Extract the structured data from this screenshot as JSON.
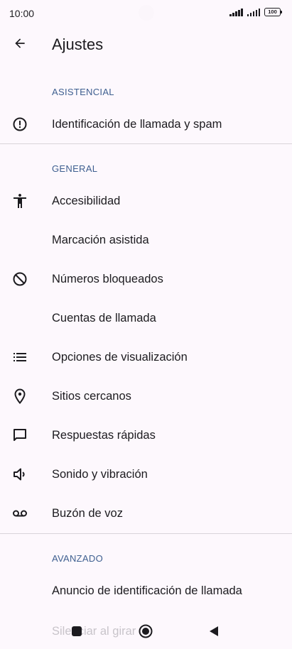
{
  "status_bar": {
    "time": "10:00",
    "battery": "100"
  },
  "header": {
    "title": "Ajustes",
    "back_icon": "arrow-back-icon"
  },
  "sections": {
    "asistencial": "ASISTENCIAL",
    "general": "GENERAL",
    "avanzado": "AVANZADO"
  },
  "items": {
    "caller_id": {
      "label": "Identificación de llamada y spam",
      "icon": "alert-circle-icon"
    },
    "accessibility": {
      "label": "Accesibilidad",
      "icon": "accessibility-icon"
    },
    "assisted_dialing": {
      "label": "Marcación asistida"
    },
    "blocked_numbers": {
      "label": "Números bloqueados",
      "icon": "block-icon"
    },
    "calling_accounts": {
      "label": "Cuentas de llamada"
    },
    "display_options": {
      "label": "Opciones de visualización",
      "icon": "list-icon"
    },
    "nearby_places": {
      "label": "Sitios cercanos",
      "icon": "location-pin-icon"
    },
    "quick_responses": {
      "label": "Respuestas rápidas",
      "icon": "chat-bubble-icon"
    },
    "sound_vibration": {
      "label": "Sonido y vibración",
      "icon": "volume-icon"
    },
    "voicemail": {
      "label": "Buzón de voz",
      "icon": "voicemail-icon"
    },
    "caller_id_announce": {
      "label": "Anuncio de identificación de llamada"
    },
    "flip_to_silence": {
      "label": "Silenciar al girar"
    }
  },
  "colors": {
    "background": "#fdf8fd",
    "section_header": "#3e5f90",
    "text": "#1c1b1f",
    "divider": "#d9d4da"
  }
}
